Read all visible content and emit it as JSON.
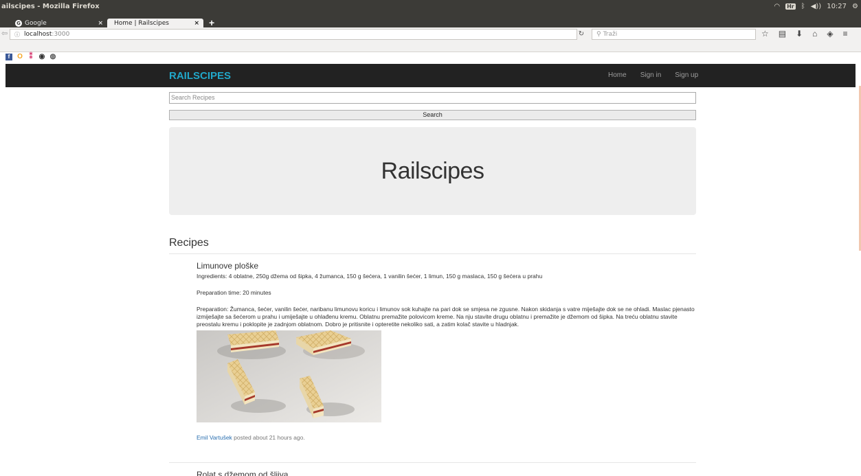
{
  "os": {
    "window_title": "ailscipes - Mozilla Firefox",
    "tray_keyboard": "Hr",
    "tray_volume": "◀))",
    "time": "10:27"
  },
  "browser": {
    "tabs": [
      {
        "label": "Google",
        "active": false
      },
      {
        "label": "Home | Railscipes",
        "active": true
      }
    ],
    "new_tab_label": "+",
    "close_label": "×",
    "url_host": "localhost",
    "url_port": ":3000",
    "search_placeholder": "Traži",
    "icons": [
      "back-icon",
      "info-icon",
      "reload-icon",
      "search-icon",
      "bookmark-star-icon",
      "reading-list-icon",
      "download-icon",
      "home-icon",
      "pocket-icon",
      "menu-icon"
    ]
  },
  "site": {
    "brand": "RAILSCIPES",
    "nav": [
      "Home",
      "Sign in",
      "Sign up"
    ],
    "search_placeholder": "Search Recipes",
    "search_button": "Search",
    "jumbotron_title": "Railscipes",
    "section_title": "Recipes",
    "recipes": [
      {
        "title": "Limunove ploške",
        "ingredients": "Ingredients: 4 oblatne, 250g džema od šipka, 4 žumanca, 150 g šećera, 1 vanilin šećer, 1 limun, 150 g maslaca, 150 g šećera u prahu",
        "prep_time": "Preparation time: 20 minutes",
        "preparation": "Preparation: Žumanca, šećer, vanilin šećer, naribanu limunovu koricu i limunov sok kuhajte na pari dok se smjesa ne zgusne. Nakon skidanja s vatre miješajte dok se ne ohladi. Maslac pjenasto izmiješajte sa šećerom u prahu i umiješajte u ohlađenu kremu. Oblatnu premažite polovicom kreme. Na nju stavite drugu oblatnu i premažite je džemom od šipka. Na treću oblatnu stavite preostalu kremu i poklopite je zadnjom oblatnom. Dobro je pritisnite i opteretite nekoliko sati, a zatim kolač stavite u hladnjak.",
        "author": "Emil Vartušek",
        "posted": " posted about 21 hours ago."
      },
      {
        "title": "Rolat s džemom od šljiva"
      }
    ]
  },
  "colors": {
    "brand": "#21a7c9",
    "navbar_bg": "#222222",
    "link": "#2a6fb0",
    "jumbotron_bg": "#eeeeee"
  }
}
